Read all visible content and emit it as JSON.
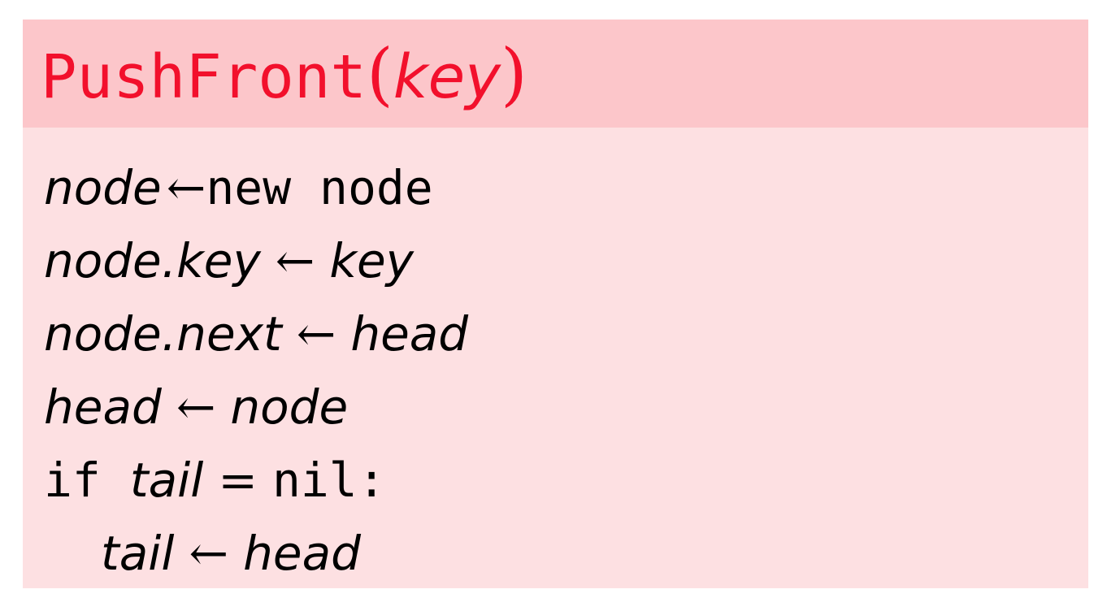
{
  "title": {
    "function_name": "PushFront",
    "open_paren": "(",
    "param": "key",
    "close_paren": ")"
  },
  "code": {
    "assign_op": "←",
    "line1": {
      "lhs": "node",
      "rhs": "new node"
    },
    "line2": {
      "lhs": "node.key",
      "rhs": "key"
    },
    "line3": {
      "lhs": "node.next",
      "rhs": "head"
    },
    "line4": {
      "lhs": "head",
      "rhs": "node"
    },
    "line5": {
      "keyword": "if",
      "var": "tail",
      "op": "=",
      "value": "nil:"
    },
    "line6": {
      "lhs": "tail",
      "rhs": "head"
    }
  }
}
